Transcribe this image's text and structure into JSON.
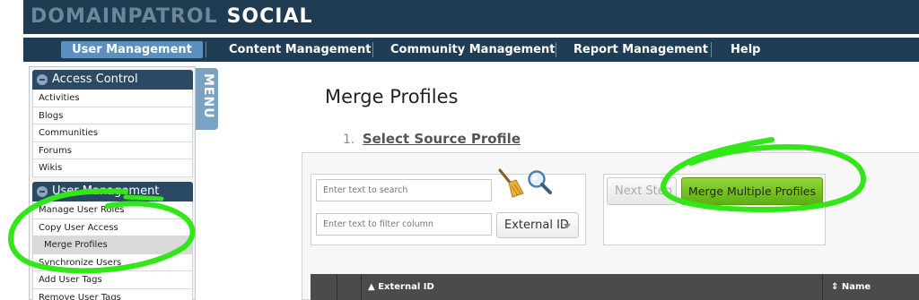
{
  "app": {
    "brand_part1": "DOMAINPATROL",
    "brand_part2": "SOCIAL",
    "colors": {
      "banner": "#1e3b52",
      "nav_active": "#5b8fbf",
      "merge_button": "#6cbd1e",
      "annotation": "#33e61a"
    }
  },
  "nav": {
    "items": [
      {
        "label": "User Management",
        "active": true
      },
      {
        "label": "Content Management",
        "active": false
      },
      {
        "label": "Community Management",
        "active": false
      },
      {
        "label": "Report Management",
        "active": false
      },
      {
        "label": "Help",
        "active": false
      }
    ]
  },
  "sidebar": {
    "tab_label": "MENU",
    "access_control": {
      "title": "Access Control",
      "items": [
        "Activities",
        "Blogs",
        "Communities",
        "Forums",
        "Wikis"
      ]
    },
    "user_management": {
      "title": "User Management",
      "items": [
        "Manage User Roles",
        "Copy User Access",
        "Merge Profiles",
        "Synchronize Users",
        "Add User Tags",
        "Remove User Tags"
      ],
      "active_item": "Merge Profiles"
    }
  },
  "main": {
    "title": "Merge Profiles",
    "step_number": "1.",
    "step_label": "Select Source Profile",
    "search_placeholder": "Enter text to search",
    "filter_placeholder": "Enter text to filter column",
    "filter_column": "External ID",
    "next_button": "Next Step",
    "merge_button": "Merge Multiple Profiles",
    "table_headers": [
      "External ID",
      "Name"
    ],
    "icons": [
      "broom-icon",
      "magnifier-icon",
      "sort-up-icon",
      "sort-updown-icon"
    ]
  }
}
